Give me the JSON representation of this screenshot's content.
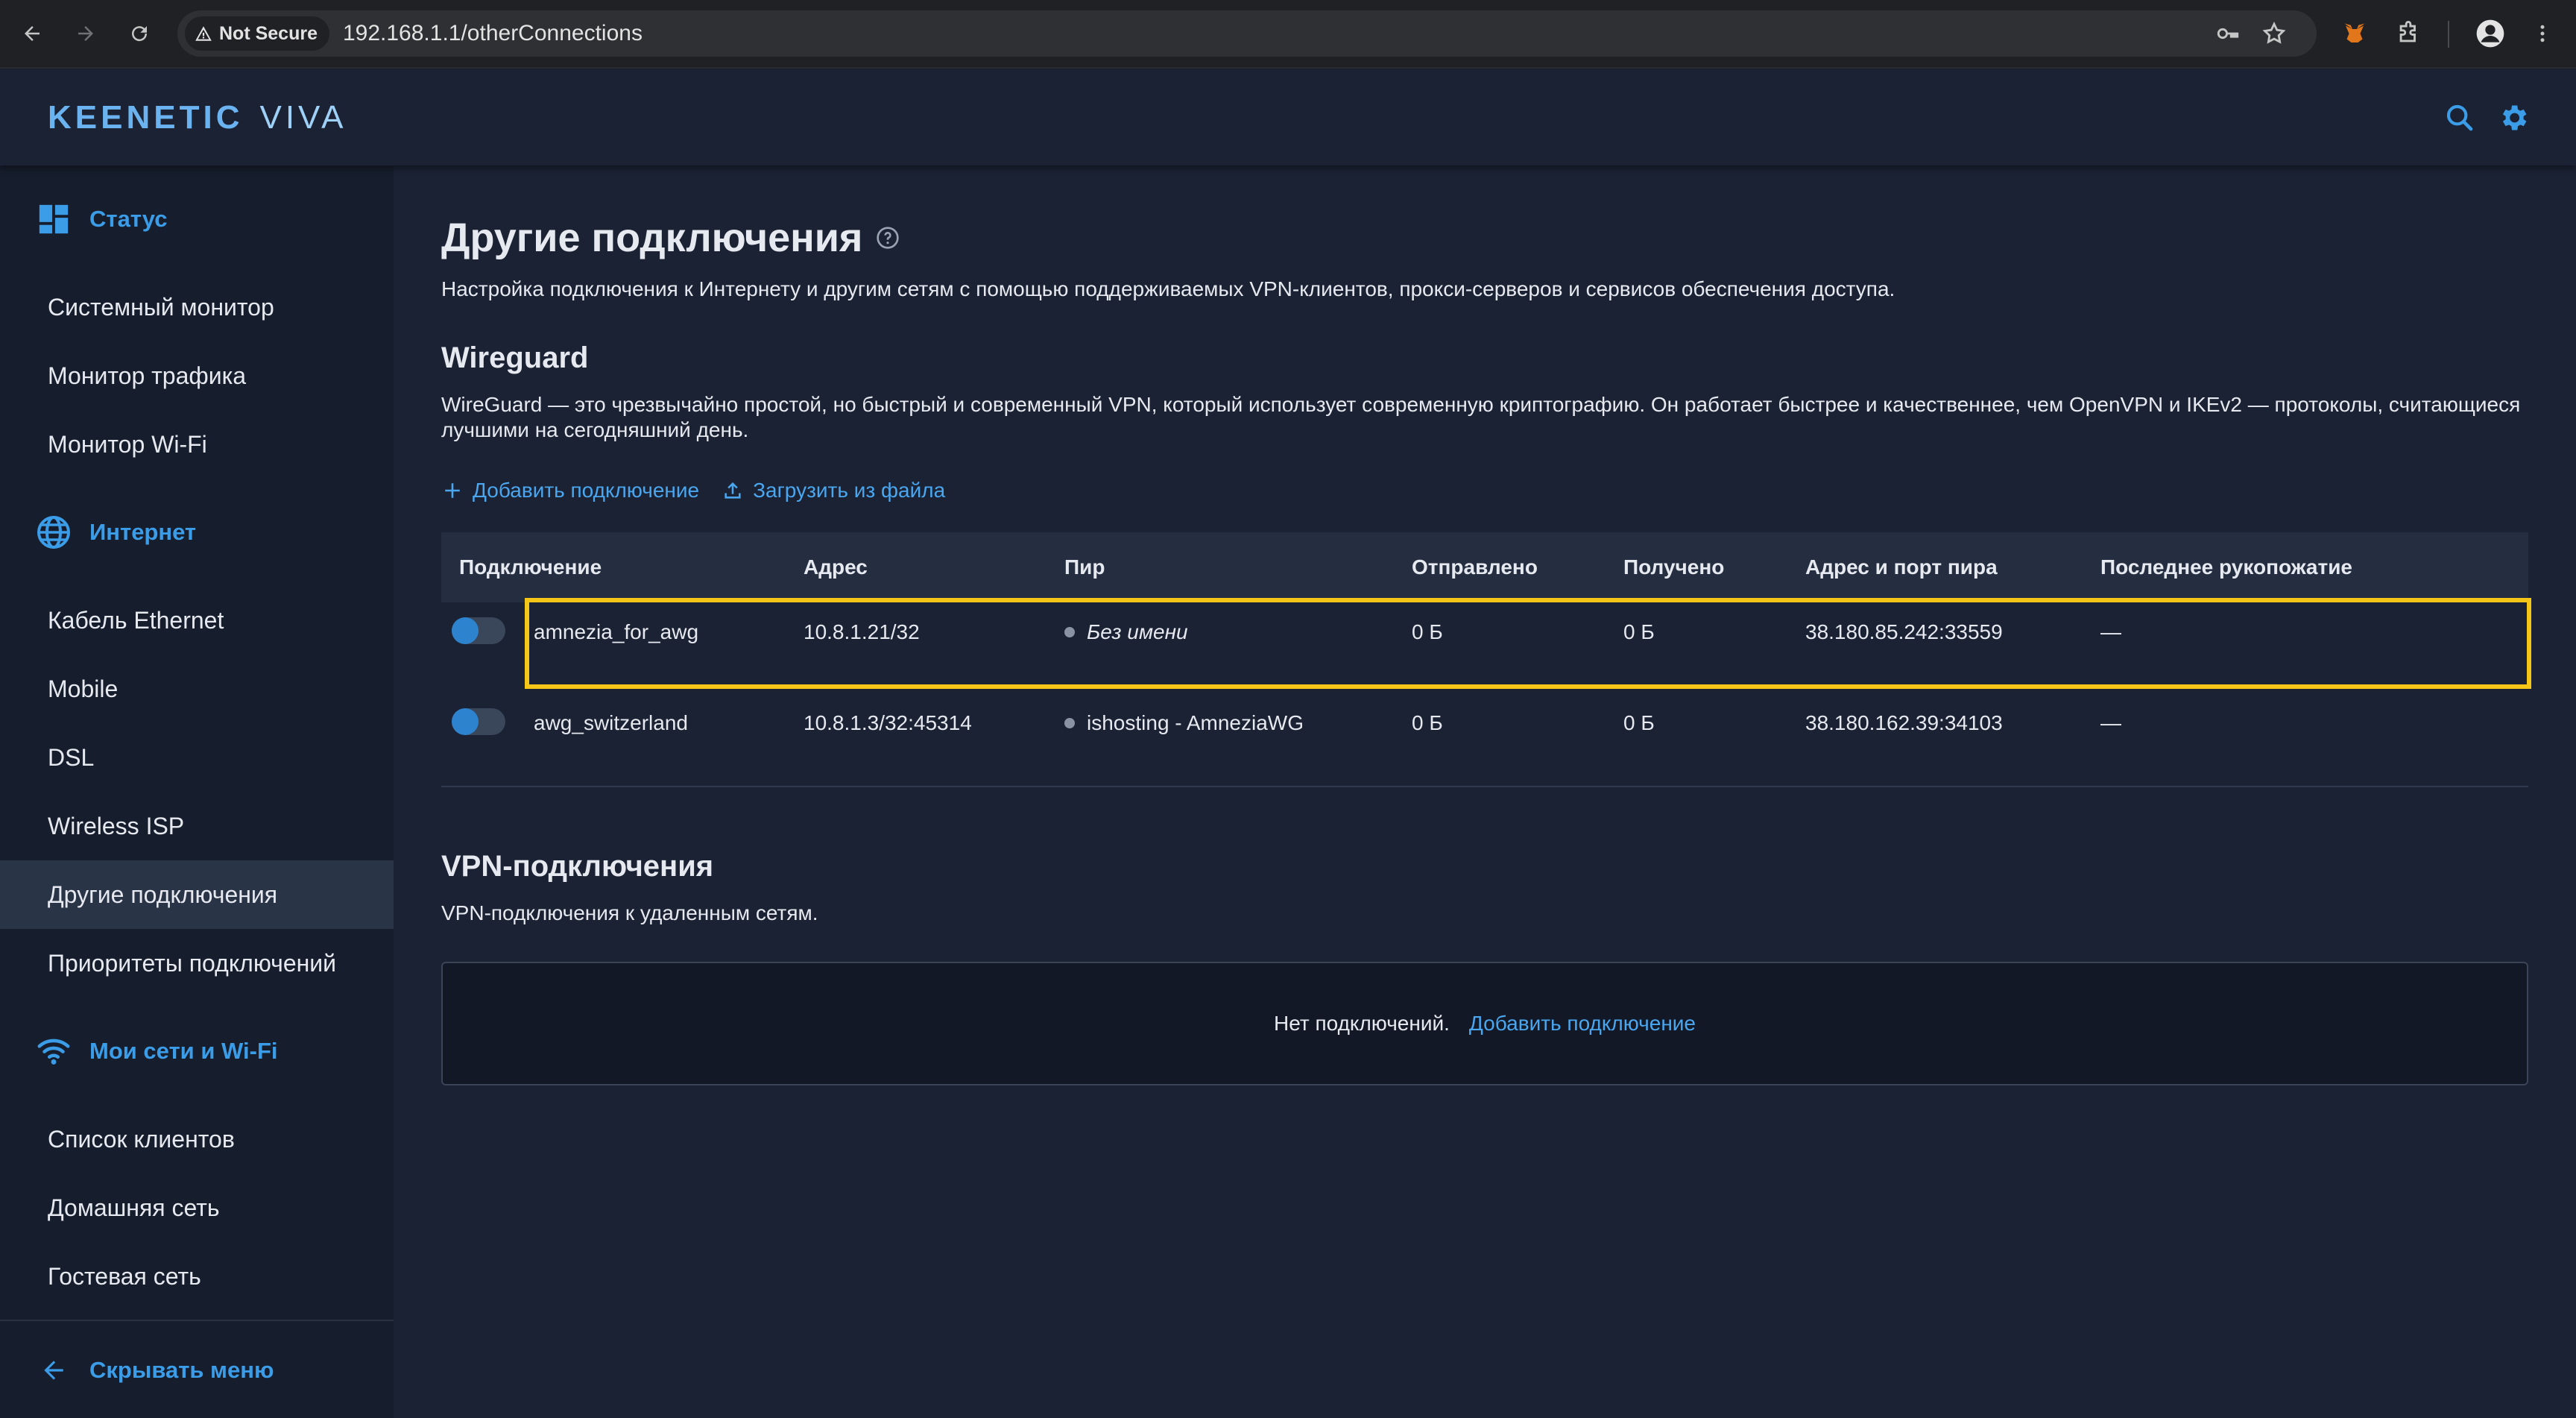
{
  "browser": {
    "security_label": "Not Secure",
    "url": "192.168.1.1/otherConnections"
  },
  "header": {
    "logo_brand": "KEENETIC",
    "logo_model": "VIVA"
  },
  "sidebar": {
    "groups": [
      {
        "label": "Статус",
        "icon": "dashboard-icon"
      },
      {
        "label": "Интернет",
        "icon": "globe-icon"
      },
      {
        "label": "Мои сети и Wi-Fi",
        "icon": "wifi-icon"
      }
    ],
    "items": [
      {
        "label": "Системный монитор"
      },
      {
        "label": "Монитор трафика"
      },
      {
        "label": "Монитор Wi-Fi"
      },
      {
        "label": "Кабель Ethernet"
      },
      {
        "label": "Mobile"
      },
      {
        "label": "DSL"
      },
      {
        "label": "Wireless ISP"
      },
      {
        "label": "Другие подключения",
        "active": true
      },
      {
        "label": "Приоритеты подключений"
      },
      {
        "label": "Список клиентов"
      },
      {
        "label": "Домашняя сеть"
      },
      {
        "label": "Гостевая сеть"
      }
    ],
    "collapse_label": "Скрывать меню"
  },
  "main": {
    "title": "Другие подключения",
    "description": "Настройка подключения к Интернету и другим сетям с помощью поддерживаемых VPN-клиентов, прокси-серверов и сервисов обеспечения доступа.",
    "wireguard": {
      "title": "Wireguard",
      "description": "WireGuard — это чрезвычайно простой, но быстрый и современный VPN, который использует современную криптографию. Он работает быстрее и качественнее, чем OpenVPN и IKEv2 — протоколы, считающиеся лучшими на сегодняшний день.",
      "add_label": "Добавить подключение",
      "upload_label": "Загрузить из файла",
      "columns": [
        "Подключение",
        "Адрес",
        "Пир",
        "Отправлено",
        "Получено",
        "Адрес и порт пира",
        "Последнее рукопожатие"
      ],
      "rows": [
        {
          "name": "amnezia_for_awg",
          "address": "10.8.1.21/32",
          "peer": "Без имени",
          "sent": "0 Б",
          "received": "0 Б",
          "peer_endpoint": "38.180.85.242:33559",
          "handshake": "—",
          "enabled": false
        },
        {
          "name": "awg_switzerland",
          "address": "10.8.1.3/32:45314",
          "peer": "ishosting - AmneziaWG",
          "sent": "0 Б",
          "received": "0 Б",
          "peer_endpoint": "38.180.162.39:34103",
          "handshake": "—",
          "enabled": false
        }
      ]
    },
    "vpn": {
      "title": "VPN-подключения",
      "description": "VPN-подключения к удаленным сетям.",
      "empty_text": "Нет подключений.",
      "add_link": "Добавить подключение"
    }
  },
  "colors": {
    "accent": "#3b9ce8",
    "highlight": "#f5c518",
    "background": "#1b2233",
    "sidebar": "#161d2c"
  }
}
